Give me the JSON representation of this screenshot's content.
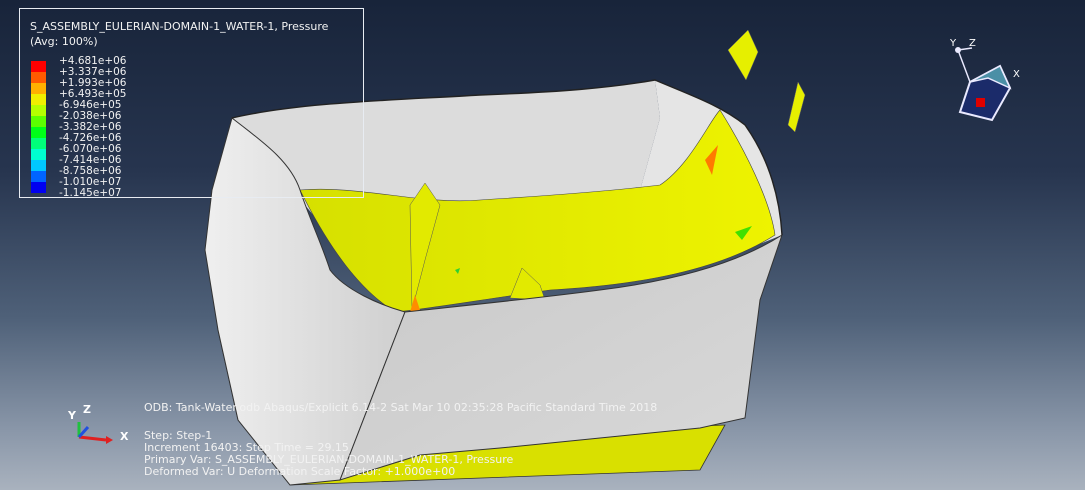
{
  "legend": {
    "title": "S_ASSEMBLY_EULERIAN-DOMAIN-1_WATER-1, Pressure",
    "avg": "(Avg: 100%)",
    "levels": [
      {
        "value": "+4.681e+06",
        "color": "#ff0000"
      },
      {
        "value": "+3.337e+06",
        "color": "#ff5a00"
      },
      {
        "value": "+1.993e+06",
        "color": "#ffb000"
      },
      {
        "value": "+6.493e+05",
        "color": "#f0ef00"
      },
      {
        "value": "-6.946e+05",
        "color": "#b4ff00"
      },
      {
        "value": "-2.038e+06",
        "color": "#5cff00"
      },
      {
        "value": "-3.382e+06",
        "color": "#00ff18"
      },
      {
        "value": "-4.726e+06",
        "color": "#00ff7a"
      },
      {
        "value": "-6.070e+06",
        "color": "#00ffd0"
      },
      {
        "value": "-7.414e+06",
        "color": "#00c8ff"
      },
      {
        "value": "-8.758e+06",
        "color": "#0064ff"
      },
      {
        "value": "-1.010e+07",
        "color": "#0000f0"
      },
      {
        "value": "-1.145e+07",
        "color": "#0000c0"
      }
    ]
  },
  "info": {
    "odb": "ODB: Tank-Water.odb    Abaqus/Explicit 6.14-2    Sat Mar 10 02:35:28 Pacific Standard Time 2018",
    "step": "Step: Step-1",
    "increment": "Increment     16403: Step Time =    29.15",
    "primary": "Primary Var: S_ASSEMBLY_EULERIAN-DOMAIN-1_WATER-1, Pressure",
    "deformed": "Deformed Var: U   Deformation Scale Factor: +1.000e+00"
  },
  "triad": {
    "x": "X",
    "y": "Y",
    "z": "Z",
    "x_color": "#e02020",
    "y_color": "#20c040",
    "z_color": "#2050e0"
  },
  "view_cube": {
    "x": "X",
    "y": "Y",
    "z": "Z"
  },
  "colors": {
    "shell": "#d8d8d8",
    "water": "#e6ef00"
  }
}
